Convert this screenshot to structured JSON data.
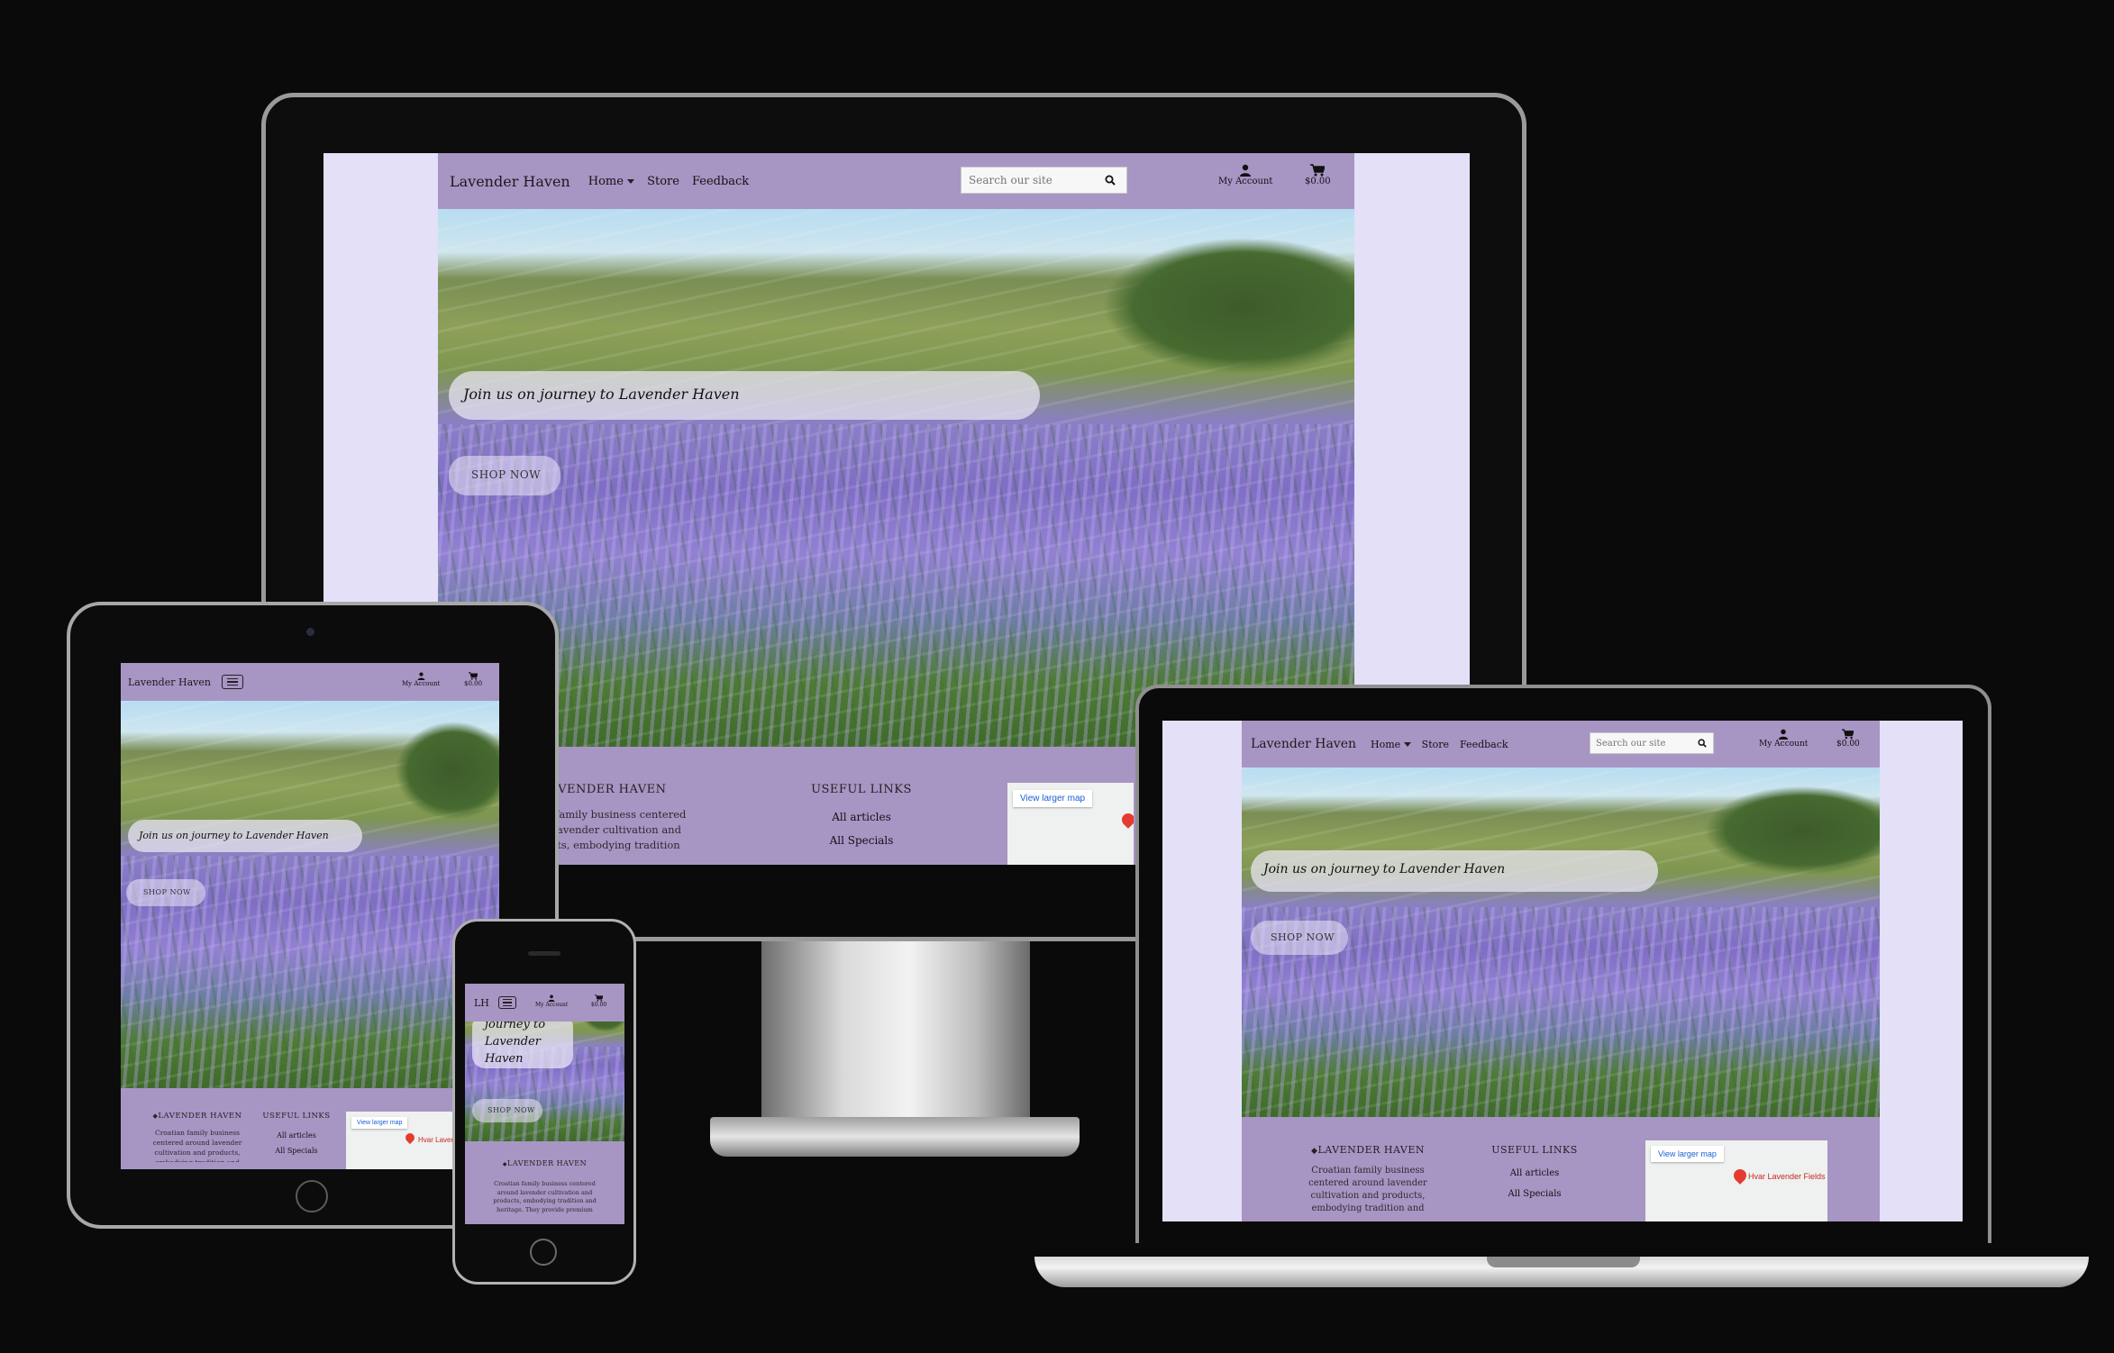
{
  "site": {
    "brand": "Lavender Haven",
    "brand_short": "LH",
    "nav": {
      "home": "Home",
      "store": "Store",
      "feedback": "Feedback"
    },
    "search_placeholder": "Search our site",
    "account_label": "My Account",
    "cart_total": "$0.00",
    "hero": {
      "tagline": "Join us on journey to Lavender Haven",
      "tagline_mobile": "journey to Lavender Haven",
      "cta": "SHOP NOW"
    },
    "footer": {
      "about_title": "LAVENDER HAVEN",
      "about_text_desktop": "roatian family business centered round lavender cultivation and products, embodying tradition and eritage. They provide premium",
      "about_text_tablet": "Croatian family business centered around lavender cultivation and products, embodying tradition and",
      "about_text_laptop": "Croatian family business centered around lavender cultivation and products, embodying tradition and",
      "about_text_phone": "Croatian family business centered around lavender cultivation and products, embodying tradition and heritage. They provide premium",
      "links_title": "USEFUL LINKS",
      "links": [
        "All articles",
        "All Specials"
      ],
      "map_button": "View larger map",
      "map_pin_label": "Hvar Lavender Fields",
      "map_pin_label_short": "Hvar Laven"
    }
  },
  "colors": {
    "background": "#0b0a0b",
    "nav_purple": "#a795c4",
    "page_lavender": "#e3e0f8",
    "pin_red": "#e43b30"
  },
  "icons": [
    "user-icon",
    "cart-icon",
    "search-icon",
    "hamburger-icon",
    "gem-icon",
    "map-pin-icon"
  ]
}
